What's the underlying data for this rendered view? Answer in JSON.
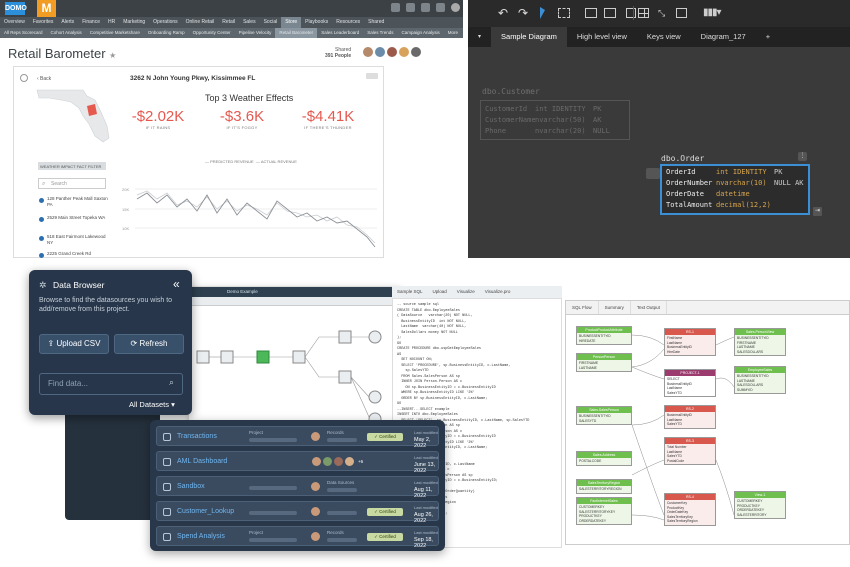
{
  "q1": {
    "logo_left": "DOMO",
    "logo_mark": "M",
    "nav": [
      "Overview",
      "Favorites",
      "Alerts",
      "Finance",
      "HR",
      "Marketing",
      "Operations",
      "Online Retail",
      "Retail",
      "Sales",
      "Social",
      "Store",
      "Playbooks",
      "Resources",
      "Shared"
    ],
    "nav_active": 11,
    "subnav": [
      "All Reps Scorecard",
      "Cohort Analysis",
      "Competitive Marketshare",
      "Onboarding Ramp",
      "Opportunity Center",
      "Pipeline Velocity",
      "Retail Barometer",
      "Sales Leaderboard",
      "Sales Trends",
      "Campaign Analysis",
      "More"
    ],
    "subnav_active": 6,
    "title": "Retail Barometer",
    "title_star": "★",
    "shared_label": "Shared",
    "shared_count": "391 People",
    "back_label": "‹ Back",
    "address": "3262 N John Young Pkwy, Kissimmee FL",
    "weather_title": "Top 3 Weather Effects",
    "effects": [
      {
        "value": "-$2.02K",
        "label": "IF IT RAINS"
      },
      {
        "value": "-$3.6K",
        "label": "IF IT'S FOGGY"
      },
      {
        "value": "-$4.41K",
        "label": "IF THERE'S THUNDER"
      }
    ],
    "select_label": "WEATHER IMPACT FACT FILTER",
    "search_placeholder": "Search",
    "stores": [
      "128 Panther Peak Mall Saxton PA",
      "2529 Main Street Topeka WA",
      "518 East Fairmont Lakewood NY",
      "2225 Grand Creek Rd"
    ],
    "legend": [
      "— PREDICTED REVENUE",
      "— ACTUAL REVENUE"
    ],
    "y_ticks": [
      "20K",
      "15K",
      "10K"
    ]
  },
  "q2": {
    "tabs": [
      "Sample Diagram",
      "High level view",
      "Keys view",
      "Diagram_127",
      "+"
    ],
    "customer": {
      "name": "dbo.Customer",
      "rows": [
        [
          "CustomerId",
          "int IDENTITY",
          "PK"
        ],
        [
          "CustomerName",
          "nvarchar(50)",
          "AK"
        ],
        [
          "Phone",
          "nvarchar(20)",
          "NULL"
        ]
      ]
    },
    "order": {
      "name": "dbo.Order",
      "rows": [
        [
          "OrderId",
          "int IDENTITY",
          "PK"
        ],
        [
          "OrderNumber",
          "nvarchar(10)",
          "NULL AK"
        ],
        [
          "OrderDate",
          "datetime",
          ""
        ],
        [
          "TotalAmount",
          "decimal(12,2)",
          ""
        ]
      ]
    }
  },
  "q3": {
    "browser_title": "Data Browser",
    "browser_desc": "Browse to find the datasources you wish to add/remove from this project.",
    "upload_label": "Upload CSV",
    "refresh_label": "Refresh",
    "find_placeholder": "Find data...",
    "all_datasets": "All Datasets",
    "flow_title": "Demo Example",
    "code_tabs": [
      "Sample SQL",
      "Upload",
      "Visualize",
      "Visualize.pro"
    ],
    "items": [
      {
        "name": "Transactions",
        "col": "Project",
        "rec": "Records",
        "badge": "Certified",
        "lm": "Last modified",
        "date": "May 2, 2022"
      },
      {
        "name": "AML Dashboard",
        "col": "",
        "rec": "",
        "badge": "",
        "lm": "Last modified",
        "date": "June 13, 2022",
        "extra": "+6"
      },
      {
        "name": "Sandbox",
        "col": "",
        "rec": "Data Sources",
        "badge": "",
        "lm": "Last modified",
        "date": "Aug 11, 2022"
      },
      {
        "name": "Customer_Lookup",
        "col": "",
        "rec": "",
        "badge": "Certified",
        "lm": "Last modified",
        "date": "Aug 26, 2022"
      },
      {
        "name": "Spend Analysis",
        "col": "Project",
        "rec": "Records",
        "badge": "Certified",
        "lm": "Last modified",
        "date": "Sep 18, 2022"
      }
    ]
  },
  "q4": {
    "tabs": [
      "SQL Flow",
      "Summary",
      "Text Output"
    ]
  }
}
